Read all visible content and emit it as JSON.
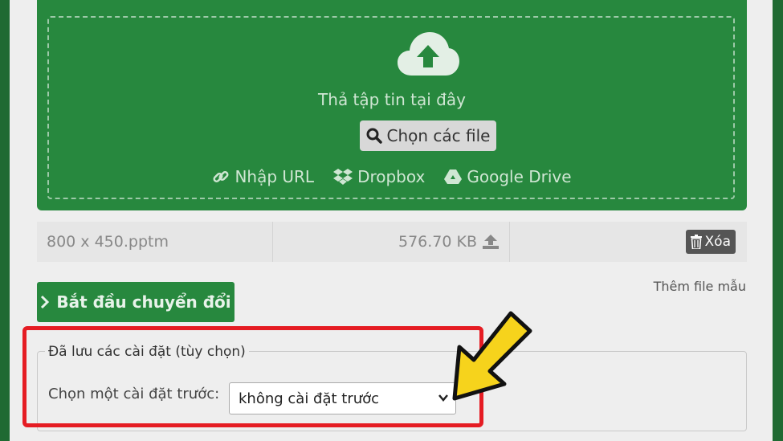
{
  "dropzone": {
    "icon": "cloud-upload-icon",
    "drop_text": "Thả tập tin tại đây",
    "choose_button": "Chọn các file",
    "sources": [
      {
        "icon": "link-icon",
        "label": "Nhập URL"
      },
      {
        "icon": "dropbox-icon",
        "label": "Dropbox"
      },
      {
        "icon": "google-drive-icon",
        "label": "Google Drive"
      }
    ]
  },
  "file": {
    "name": "800 x 450.pptm",
    "size": "576.70 KB",
    "delete_label": "Xóa"
  },
  "actions": {
    "start_button": "Bắt đầu chuyển đổi",
    "sample_link": "Thêm file mẫu"
  },
  "settings": {
    "legend": "Đã lưu các cài đặt (tùy chọn)",
    "preset_label": "Chọn một cài đặt trước:",
    "preset_value": "không cài đặt trước"
  },
  "colors": {
    "brand_green": "#27883e",
    "highlight_red": "#e51c23",
    "arrow_yellow": "#f6d31c"
  }
}
